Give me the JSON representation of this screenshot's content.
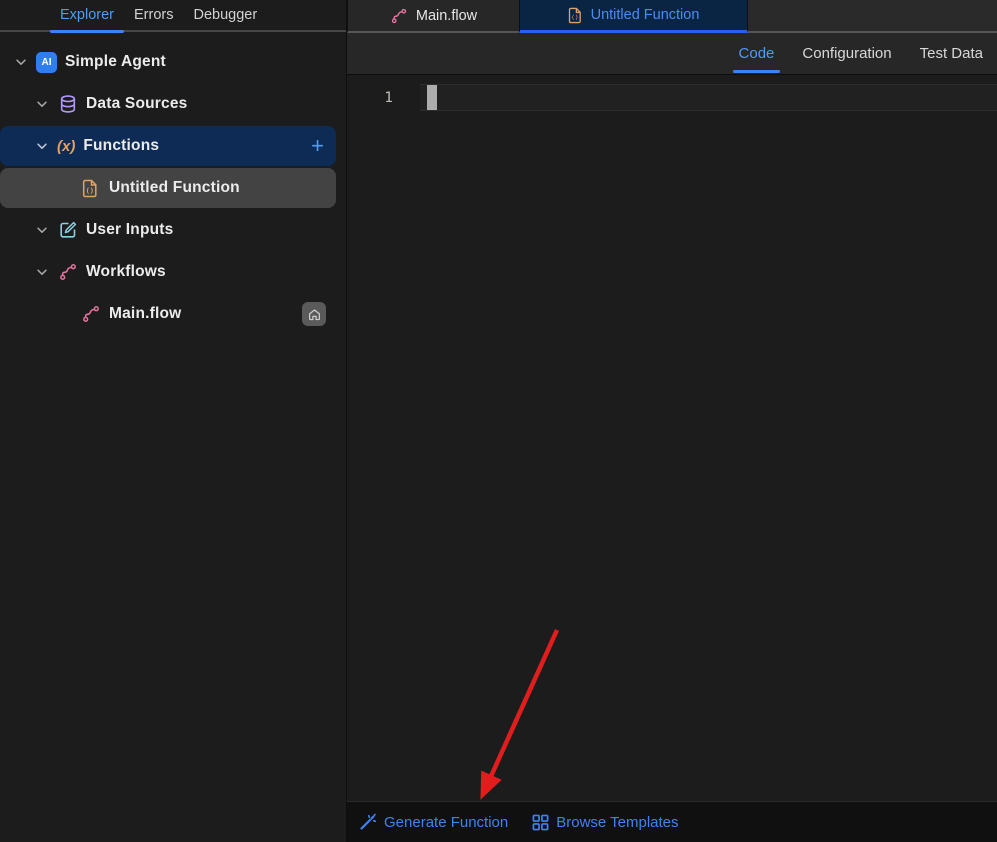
{
  "sidebar": {
    "tabs": [
      {
        "label": "Explorer",
        "active": true
      },
      {
        "label": "Errors",
        "active": false
      },
      {
        "label": "Debugger",
        "active": false
      }
    ],
    "tree": {
      "root": {
        "label": "Simple Agent"
      },
      "data_sources": {
        "label": "Data Sources"
      },
      "functions": {
        "label": "Functions"
      },
      "untitled_function": {
        "label": "Untitled Function"
      },
      "user_inputs": {
        "label": "User Inputs"
      },
      "workflows": {
        "label": "Workflows"
      },
      "main_flow": {
        "label": "Main.flow"
      }
    }
  },
  "editor_tabs": {
    "main_flow": "Main.flow",
    "untitled_function": "Untitled Function"
  },
  "view_tabs": {
    "code": "Code",
    "configuration": "Configuration",
    "test_data": "Test Data"
  },
  "editor": {
    "line_number": "1"
  },
  "footer": {
    "generate_function": "Generate Function",
    "browse_templates": "Browse Templates"
  },
  "icons": {
    "ai_badge": "AI",
    "functions_glyph": "(x)",
    "plus": "+"
  },
  "colors": {
    "accent_blue": "#4f9cf5",
    "link_blue": "#3f83f0",
    "selection_navy": "#0d2b55",
    "active_tab_navy": "#0a2444",
    "orange": "#e1a264",
    "pink": "#e5729f",
    "teal": "#8ecfe4",
    "purple": "#b197fc",
    "annotation_red": "#e11d1d"
  }
}
